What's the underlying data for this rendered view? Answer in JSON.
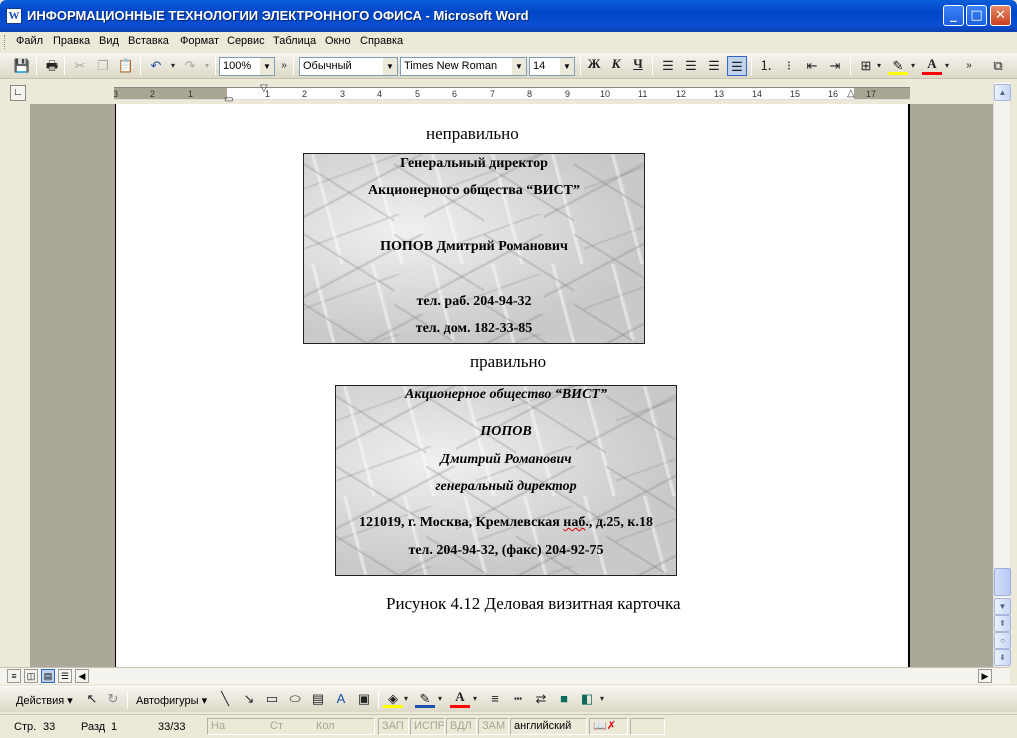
{
  "window": {
    "title": "ИНФОРМАЦИОННЫЕ ТЕХНОЛОГИИ ЭЛЕКТРОННОГО ОФИСА - Microsoft Word",
    "app_icon": "word-document-icon"
  },
  "menu": [
    "Файл",
    "Правка",
    "Вид",
    "Вставка",
    "Формат",
    "Сервис",
    "Таблица",
    "Окно",
    "Справка"
  ],
  "toolbar": {
    "zoom": "100%",
    "style": "Обычный",
    "font": "Times New Roman",
    "size": "14",
    "bold": "Ж",
    "italic": "К",
    "underline": "Ч"
  },
  "ruler": {
    "ticks": [
      "3",
      "2",
      "1",
      "1",
      "2",
      "3",
      "4",
      "5",
      "6",
      "7",
      "8",
      "9",
      "10",
      "11",
      "12",
      "13",
      "14",
      "15",
      "16",
      "17"
    ]
  },
  "document": {
    "label_wrong": "неправильно",
    "label_right": "правильно",
    "card_wrong": {
      "line1": "Генеральный директор",
      "line2": "Акционерного общества “ВИСТ”",
      "line3": "ПОПОВ Дмитрий Романович",
      "line4": "тел. раб. 204-94-32",
      "line5": "тел. дом. 182-33-85"
    },
    "card_right": {
      "line1": "Акционерное общество “ВИСТ”",
      "line2": "ПОПОВ",
      "line3": "Дмитрий Романович",
      "line4": "генеральный директор",
      "line5_a": "121019, г. Москва, Кремлевская ",
      "line5_b": "наб",
      "line5_c": "., д.25, к.18",
      "line6": "тел. 204-94-32, (факс) 204-92-75"
    },
    "caption": "Рисунок 4.12  Деловая визитная карточка"
  },
  "drawing_toolbar": {
    "actions": "Действия",
    "autoshapes": "Автофигуры"
  },
  "status": {
    "page": "Стр.",
    "page_num": "33",
    "section": "Разд",
    "section_num": "1",
    "pages": "33/33",
    "at": "На",
    "line": "Ст",
    "col": "Кол",
    "rec": "ЗАП",
    "trk": "ИСПР",
    "ext": "ВДЛ",
    "ovr": "ЗАМ",
    "language": "английский"
  },
  "colors": {
    "titlebar": "#0a5fd8",
    "highlight": "#ffff00",
    "font_color": "#ff0000"
  }
}
